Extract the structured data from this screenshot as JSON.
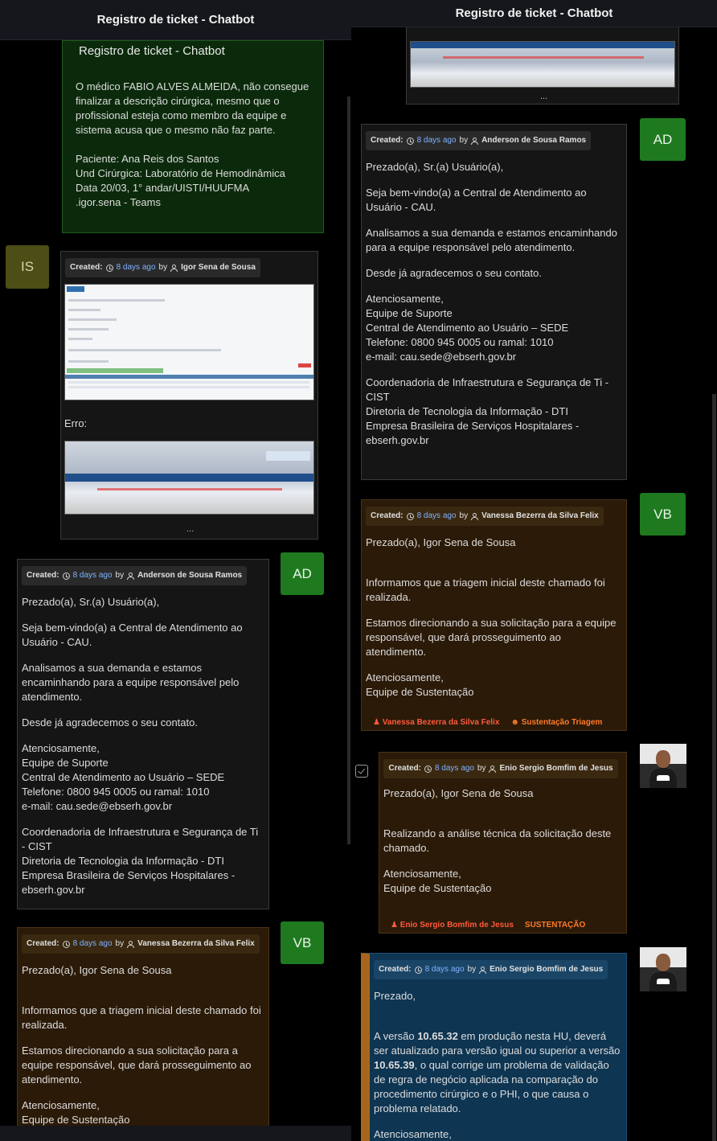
{
  "window_title": "Registro de ticket - Chatbot",
  "meta_labels": {
    "created": "Created:",
    "ago": "8 days ago",
    "by": "by"
  },
  "left": {
    "first_card": {
      "title": "Registro de ticket - Chatbot",
      "body": "O médico FABIO ALVES ALMEIDA, não consegue finalizar a descrição cirúrgica, mesmo que o profissional esteja como membro da equipe e sistema acusa que o mesmo não faz parte.",
      "details": "Paciente: Ana Reis dos Santos\nUnd Cirúrgica: Laboratório de Hemodinâmica\nData 20/03, 1° andar/UISTI/HUUFMA\n.igor.sena - Teams"
    },
    "igor_msg": {
      "avatar": "IS",
      "author": "Igor Sena de Sousa",
      "error_label": "Erro:",
      "ellipsis": "..."
    },
    "anderson_msg": {
      "avatar": "AD",
      "author": "Anderson de Sousa Ramos",
      "p1": "Prezado(a), Sr.(a) Usuário(a),",
      "p2": "Seja bem-vindo(a) a Central de Atendimento ao Usuário - CAU.",
      "p3": "Analisamos a sua demanda e estamos encaminhando para a equipe responsável pelo atendimento.",
      "p4": "Desde já agradecemos o seu contato.",
      "p5": "Atenciosamente,\nEquipe de Suporte\nCentral de Atendimento ao Usuário – SEDE\nTelefone: 0800 945 0005 ou ramal: 1010\ne-mail: cau.sede@ebserh.gov.br",
      "p6": "Coordenadoria de Infraestrutura e Segurança de Ti - CIST\nDiretoria de Tecnologia da Informação - DTI\nEmpresa Brasileira de Serviços Hospitalares - ebserh.gov.br"
    },
    "vanessa_msg": {
      "avatar": "VB",
      "author": "Vanessa Bezerra da Silva Felix",
      "p1": "Prezado(a), Igor Sena de Sousa",
      "p2": "Informamos que a triagem inicial deste chamado foi realizada.",
      "p3": "Estamos direcionando a sua solicitação para a equipe responsável, que dará prosseguimento ao atendimento.",
      "p4": "Atenciosamente,\nEquipe de Sustentação"
    }
  },
  "right": {
    "top_ellipsis": "...",
    "anderson_msg": {
      "avatar": "AD",
      "author": "Anderson de Sousa Ramos",
      "p1": "Prezado(a), Sr.(a) Usuário(a),",
      "p2": "Seja bem-vindo(a) a Central de Atendimento ao Usuário - CAU.",
      "p3": "Analisamos a sua demanda e estamos encaminhando para a equipe responsável pelo atendimento.",
      "p4": "Desde já agradecemos o seu contato.",
      "p5": "Atenciosamente,\nEquipe de Suporte\nCentral de Atendimento ao Usuário – SEDE\nTelefone: 0800 945 0005 ou ramal: 1010\ne-mail: cau.sede@ebserh.gov.br",
      "p6": "Coordenadoria de Infraestrutura e Segurança de Ti - CIST\nDiretoria de Tecnologia da Informação - DTI\nEmpresa Brasileira de Serviços Hospitalares - ebserh.gov.br"
    },
    "vanessa_msg": {
      "avatar": "VB",
      "author": "Vanessa Bezerra da Silva Felix",
      "p1": "Prezado(a), Igor Sena de Sousa",
      "p2": "Informamos que a triagem inicial deste chamado foi realizada.",
      "p3": "Estamos direcionando a sua solicitação para a equipe responsável, que dará prosseguimento ao atendimento.",
      "p4": "Atenciosamente,\nEquipe de Sustentação",
      "tag_user": "Vanessa Bezerra da Silva Felix",
      "tag_group": "Sustentação Triagem"
    },
    "enio_msg1": {
      "author": "Enio Sergio Bomfim de Jesus",
      "p1": "Prezado(a), Igor Sena de Sousa",
      "p2": "Realizando a análise técnica da solicitação deste chamado.",
      "p3": "Atenciosamente,\nEquipe de Sustentação",
      "tag_user": "Enio Sergio Bomfim de Jesus",
      "tag_group": "SUSTENTAÇÃO"
    },
    "enio_msg2": {
      "author": "Enio Sergio Bomfim de Jesus",
      "p1": "Prezado,",
      "p2_a": "A versão ",
      "p2_v1": "10.65.32",
      "p2_b": " em produção nesta HU, deverá ser atualizado para versão igual ou superior a versão ",
      "p2_v2": "10.65.39",
      "p2_c": ", o qual corrige um problema de validação de regra de negócio aplicada na comparação do procedimento cirúrgico e o PHI, o que causa o problema relatado.",
      "p3": "Atenciosamente,"
    }
  },
  "colors": {
    "green_card": "#0b2a0b",
    "dark_card": "#151515",
    "brown_card": "#2b1a08",
    "blue_card": "#0e3552",
    "avatar_green": "#1f7a1f",
    "link_blue": "#7fb2ff",
    "tag_red": "#ff5a3c"
  }
}
